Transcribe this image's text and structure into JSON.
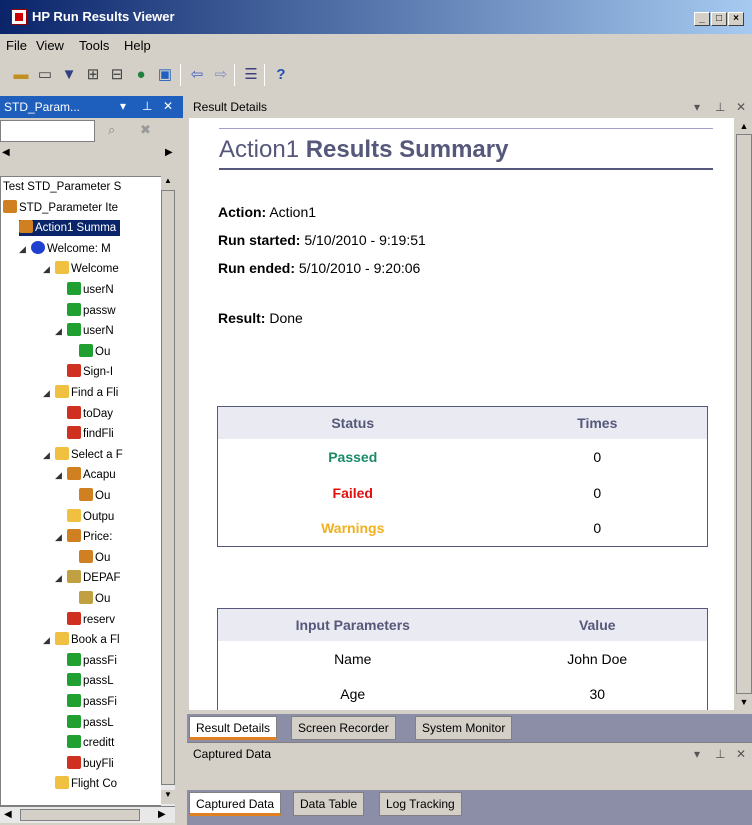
{
  "window": {
    "title": "HP Run Results Viewer"
  },
  "menu": [
    "File",
    "View",
    "Tools",
    "Help"
  ],
  "toolbar": [
    "open-icon",
    "filter-icon",
    "expand-all-icon",
    "collapse-all-icon",
    "search-icon",
    "export-icon",
    "back-icon",
    "forward-icon",
    "list-icon",
    "help-icon"
  ],
  "left_pane": {
    "title": "STD_Param...",
    "tree": [
      {
        "label": "Test STD_Parameter S",
        "indent": 0,
        "icon": "none"
      },
      {
        "label": "STD_Parameter Ite",
        "indent": 0,
        "icon": "cube"
      },
      {
        "label": "Action1 Summa",
        "indent": 1,
        "icon": "cube",
        "selected": true
      },
      {
        "label": "Welcome: M",
        "indent": 2,
        "icon": "blue"
      },
      {
        "label": "Welcome",
        "indent": 4,
        "icon": "folder"
      },
      {
        "label": "userN",
        "indent": 5,
        "icon": "logo"
      },
      {
        "label": "passw",
        "indent": 5,
        "icon": "logo"
      },
      {
        "label": "userN",
        "indent": 5,
        "icon": "logo"
      },
      {
        "label": "Ou",
        "indent": 6,
        "icon": "logo"
      },
      {
        "label": "Sign-I",
        "indent": 5,
        "icon": "red"
      },
      {
        "label": "Find a Fli",
        "indent": 4,
        "icon": "folder"
      },
      {
        "label": "toDay",
        "indent": 5,
        "icon": "red"
      },
      {
        "label": "findFli",
        "indent": 5,
        "icon": "red"
      },
      {
        "label": "Select a F",
        "indent": 4,
        "icon": "folder"
      },
      {
        "label": "Acapu",
        "indent": 5,
        "icon": "cube"
      },
      {
        "label": "Ou",
        "indent": 6,
        "icon": "cube"
      },
      {
        "label": "Outpu",
        "indent": 5,
        "icon": "folder"
      },
      {
        "label": "Price:",
        "indent": 5,
        "icon": "cube"
      },
      {
        "label": "Ou",
        "indent": 6,
        "icon": "cube"
      },
      {
        "label": "DEPAF",
        "indent": 5,
        "icon": "grid"
      },
      {
        "label": "Ou",
        "indent": 6,
        "icon": "grid"
      },
      {
        "label": "reserv",
        "indent": 5,
        "icon": "red"
      },
      {
        "label": "Book a Fl",
        "indent": 4,
        "icon": "folder"
      },
      {
        "label": "passFi",
        "indent": 5,
        "icon": "logo"
      },
      {
        "label": "passL",
        "indent": 5,
        "icon": "logo"
      },
      {
        "label": "passFi",
        "indent": 5,
        "icon": "logo"
      },
      {
        "label": "passL",
        "indent": 5,
        "icon": "logo"
      },
      {
        "label": "creditt",
        "indent": 5,
        "icon": "logo"
      },
      {
        "label": "buyFli",
        "indent": 5,
        "icon": "red"
      },
      {
        "label": "Flight Co",
        "indent": 4,
        "icon": "folder"
      }
    ]
  },
  "main": {
    "header": "Result Details",
    "title_part1": "Action1 ",
    "title_part2": "Results Summary",
    "action_label": "Action:",
    "action_value": " Action1",
    "run_started_label": "Run started:",
    "run_started_value": " 5/10/2010 - 9:19:51",
    "run_ended_label": "Run ended:",
    "run_ended_value": " 5/10/2010 - 9:20:06",
    "result_label": "Result:",
    "result_value": " Done",
    "status_table": {
      "headers": [
        "Status",
        "Times"
      ],
      "rows": [
        {
          "status": "Passed",
          "times": "0",
          "color": "#1a8a6a"
        },
        {
          "status": "Failed",
          "times": "0",
          "color": "#e01010"
        },
        {
          "status": "Warnings",
          "times": "0",
          "color": "#f0b020"
        }
      ]
    },
    "params_table": {
      "headers": [
        "Input Parameters",
        "Value"
      ],
      "rows": [
        {
          "name": "Name",
          "value": "John Doe"
        },
        {
          "name": "Age",
          "value": "30"
        }
      ]
    }
  },
  "tabs_main": [
    "Result Details",
    "Screen Recorder",
    "System Monitor"
  ],
  "captured": {
    "header": "Captured Data"
  },
  "tabs_bottom": [
    "Captured Data",
    "Data Table",
    "Log Tracking"
  ]
}
